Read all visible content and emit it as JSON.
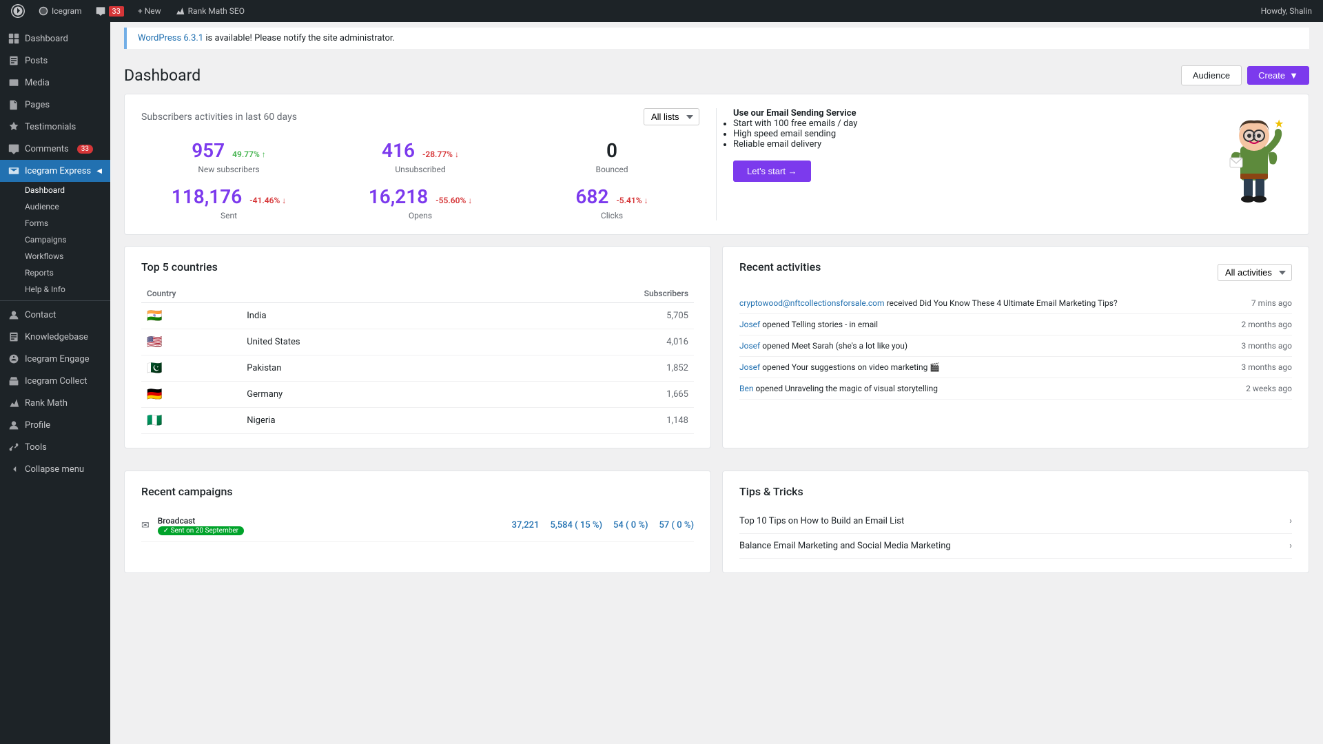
{
  "adminbar": {
    "site_name": "Icegram",
    "comments_count": "33",
    "new_label": "+ New",
    "seo_label": "Rank Math SEO",
    "howdy": "Howdy, Shalin"
  },
  "notice": {
    "version": "WordPress 6.3.1",
    "message": " is available! Please notify the site administrator."
  },
  "header": {
    "title": "Dashboard",
    "audience_btn": "Audience",
    "create_btn": "Create"
  },
  "sidebar": {
    "items": [
      {
        "label": "Dashboard",
        "icon": "grid"
      },
      {
        "label": "Posts",
        "icon": "doc"
      },
      {
        "label": "Media",
        "icon": "image"
      },
      {
        "label": "Pages",
        "icon": "file"
      },
      {
        "label": "Testimonials",
        "icon": "quote"
      },
      {
        "label": "Comments",
        "icon": "bubble",
        "badge": "33"
      },
      {
        "label": "Icegram Express",
        "icon": "mail",
        "active": true
      }
    ],
    "submenu": [
      {
        "label": "Dashboard",
        "active": true
      },
      {
        "label": "Audience"
      },
      {
        "label": "Forms"
      },
      {
        "label": "Campaigns"
      },
      {
        "label": "Workflows"
      },
      {
        "label": "Reports"
      },
      {
        "label": "Help & Info"
      }
    ],
    "bottom_items": [
      {
        "label": "Contact",
        "icon": "person"
      },
      {
        "label": "Knowledgebase",
        "icon": "book"
      },
      {
        "label": "Icegram Engage",
        "icon": "chat"
      },
      {
        "label": "Icegram Collect",
        "icon": "collect"
      },
      {
        "label": "Rank Math",
        "icon": "rank"
      },
      {
        "label": "Profile",
        "icon": "user"
      },
      {
        "label": "Tools",
        "icon": "tools"
      },
      {
        "label": "Collapse menu",
        "icon": "arrow"
      }
    ]
  },
  "stats_section": {
    "title": "Subscribers activities in last 60 days",
    "filter": "All lists",
    "metrics": [
      {
        "value": "957",
        "change": "49.77%",
        "direction": "up",
        "label": "New subscribers"
      },
      {
        "value": "416",
        "change": "-28.77%",
        "direction": "down",
        "label": "Unsubscribed"
      },
      {
        "value": "0",
        "change": "",
        "direction": "",
        "label": "Bounced"
      },
      {
        "value": "118,176",
        "change": "-41.46%",
        "direction": "down",
        "label": "Sent"
      },
      {
        "value": "16,218",
        "change": "-55.60%",
        "direction": "down",
        "label": "Opens"
      },
      {
        "value": "682",
        "change": "-5.41%",
        "direction": "down",
        "label": "Clicks"
      }
    ]
  },
  "email_service": {
    "title": "Use our Email Sending Service",
    "features": [
      "Start with 100 free emails / day",
      "High speed email sending",
      "Reliable email delivery"
    ],
    "cta": "Let's start →"
  },
  "countries": {
    "title": "Top 5 countries",
    "col_country": "Country",
    "col_subscribers": "Subscribers",
    "rows": [
      {
        "flag": "🇮🇳",
        "name": "India",
        "count": "5,705"
      },
      {
        "flag": "🇺🇸",
        "name": "United States",
        "count": "4,016"
      },
      {
        "flag": "🇵🇰",
        "name": "Pakistan",
        "count": "1,852"
      },
      {
        "flag": "🇩🇪",
        "name": "Germany",
        "count": "1,665"
      },
      {
        "flag": "🇳🇬",
        "name": "Nigeria",
        "count": "1,148"
      }
    ]
  },
  "activities": {
    "title": "Recent activities",
    "filter": "All activities",
    "items": [
      {
        "actor": "cryptowood@nftcollectionsforsale.com",
        "action": " received Did You Know These 4 Ultimate Email Marketing Tips?",
        "time": "7 mins ago"
      },
      {
        "actor": "Josef",
        "action": " opened Telling stories - in email",
        "time": "2 months ago"
      },
      {
        "actor": "Josef",
        "action": " opened Meet Sarah (she's a lot like you)",
        "time": "3 months ago"
      },
      {
        "actor": "Josef",
        "action": " opened Your suggestions on video marketing",
        "time": "3 months ago"
      },
      {
        "actor": "Ben",
        "action": " opened Unraveling the magic of visual storytelling",
        "time": "2 weeks ago"
      }
    ]
  },
  "recent_campaigns": {
    "title": "Recent campaigns",
    "items": [
      {
        "type": "broadcast",
        "name": "Broadcast",
        "status": "Sent on 20 September",
        "sent": "37,221",
        "opens": "5,584 ( 15 %)",
        "clicks": "54 ( 0 %)",
        "unsub": "57 ( 0 %)"
      }
    ]
  },
  "tips": {
    "title": "Tips & Tricks",
    "items": [
      {
        "text": "Top 10 Tips on How to Build an Email List"
      },
      {
        "text": "Balance Email Marketing and Social Media Marketing"
      }
    ]
  }
}
